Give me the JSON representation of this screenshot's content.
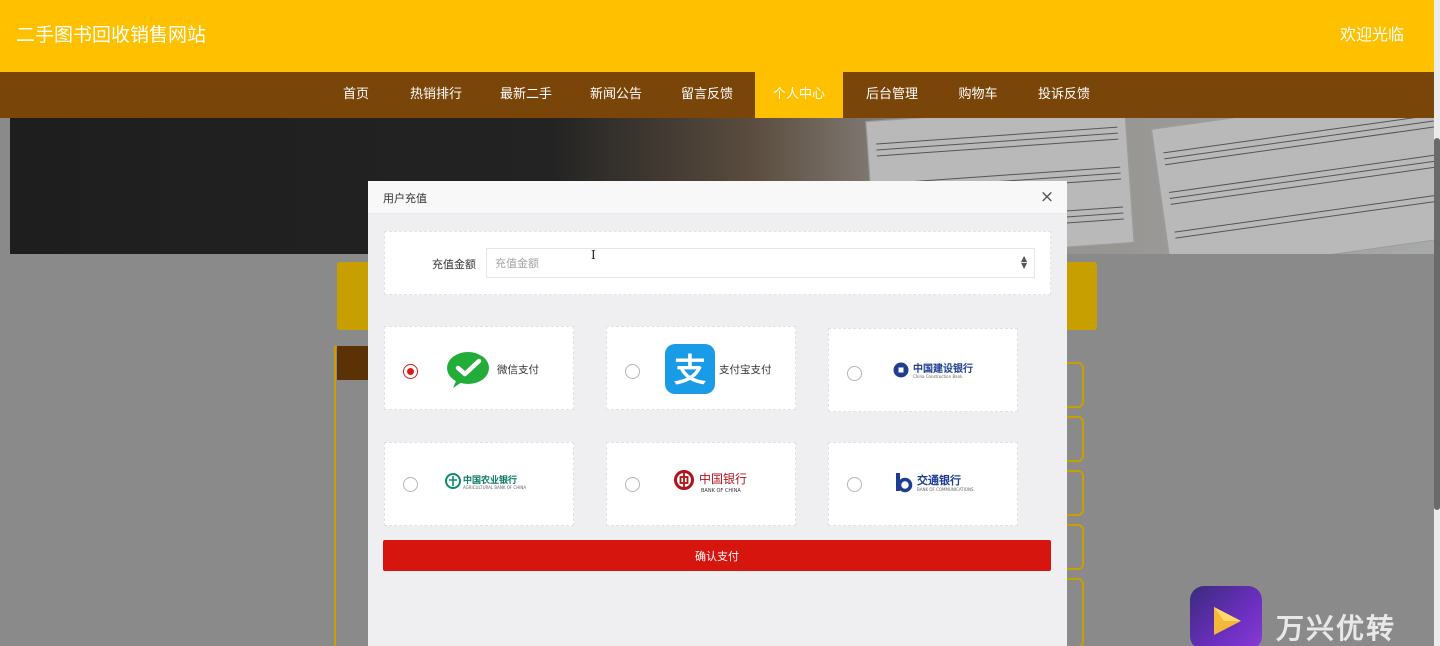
{
  "header": {
    "site_title": "二手图书回收销售网站",
    "welcome": "欢迎光临"
  },
  "nav": {
    "items": [
      {
        "label": "首页"
      },
      {
        "label": "热销排行"
      },
      {
        "label": "最新二手"
      },
      {
        "label": "新闻公告"
      },
      {
        "label": "留言反馈"
      },
      {
        "label": "个人中心"
      },
      {
        "label": "后台管理"
      },
      {
        "label": "购物车"
      },
      {
        "label": "投诉反馈"
      }
    ],
    "active_item": "个人中心"
  },
  "modal": {
    "title": "用户充值",
    "close_icon": "×",
    "amount_label": "充值金额",
    "amount_placeholder": "充值金额",
    "amount_value": "",
    "payment_methods": [
      {
        "label": "微信支付",
        "icon": "wechat-pay-icon",
        "selected": true
      },
      {
        "label": "支付宝支付",
        "icon": "alipay-icon",
        "selected": false
      },
      {
        "label": "中国建设银行",
        "sublabel": "China Construction Bank",
        "icon": "ccb-logo",
        "selected": false
      },
      {
        "label": "中国农业银行",
        "sublabel": "AGRICULTURAL BANK OF CHINA",
        "icon": "abc-logo",
        "selected": false
      },
      {
        "label": "中国银行",
        "sublabel": "BANK OF CHINA",
        "icon": "boc-logo",
        "selected": false
      },
      {
        "label": "交通银行",
        "sublabel": "BANK OF COMMUNICATIONS",
        "icon": "bocom-logo",
        "selected": false
      }
    ],
    "confirm_label": "确认支付"
  },
  "watermark": {
    "text": "万兴优转"
  },
  "colors": {
    "header_yellow": "#ffc000",
    "nav_brown": "#7a4508",
    "confirm_red": "#d7150f",
    "wechat_green": "#22ac38",
    "alipay_blue": "#1a9be8"
  }
}
